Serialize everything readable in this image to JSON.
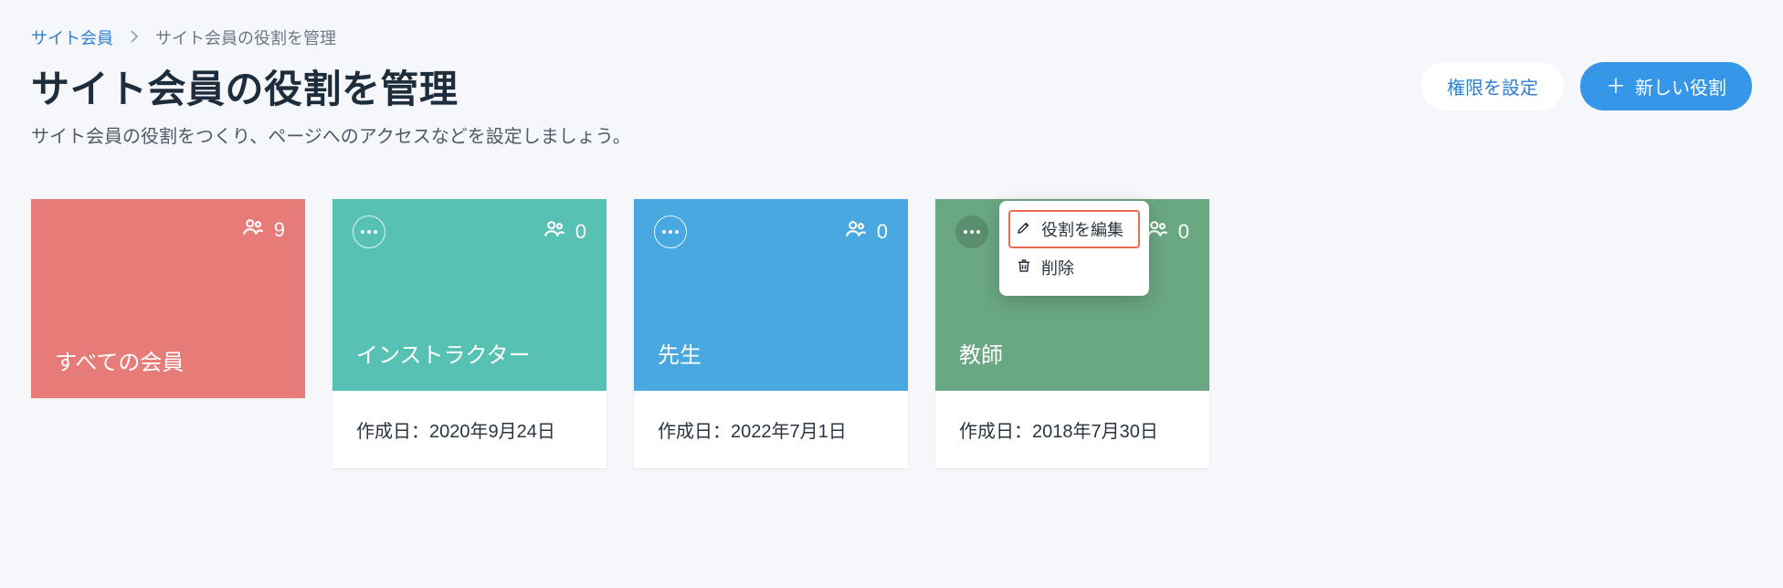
{
  "breadcrumb": {
    "root": "サイト会員",
    "current": "サイト会員の役割を管理"
  },
  "header": {
    "title": "サイト会員の役割を管理",
    "subtitle": "サイト会員の役割をつくり、ページへのアクセスなどを設定しましょう。",
    "permissions_button": "権限を設定",
    "new_role_button": "新しい役割"
  },
  "cards": [
    {
      "name": "すべての会員",
      "count": "9",
      "created": null
    },
    {
      "name": "インストラクター",
      "count": "0",
      "created": "作成日：2020年9月24日"
    },
    {
      "name": "先生",
      "count": "0",
      "created": "作成日：2022年7月1日"
    },
    {
      "name": "教師",
      "count": "0",
      "created": "作成日：2018年7月30日"
    }
  ],
  "dropdown": {
    "edit": "役割を編集",
    "delete": "削除"
  }
}
